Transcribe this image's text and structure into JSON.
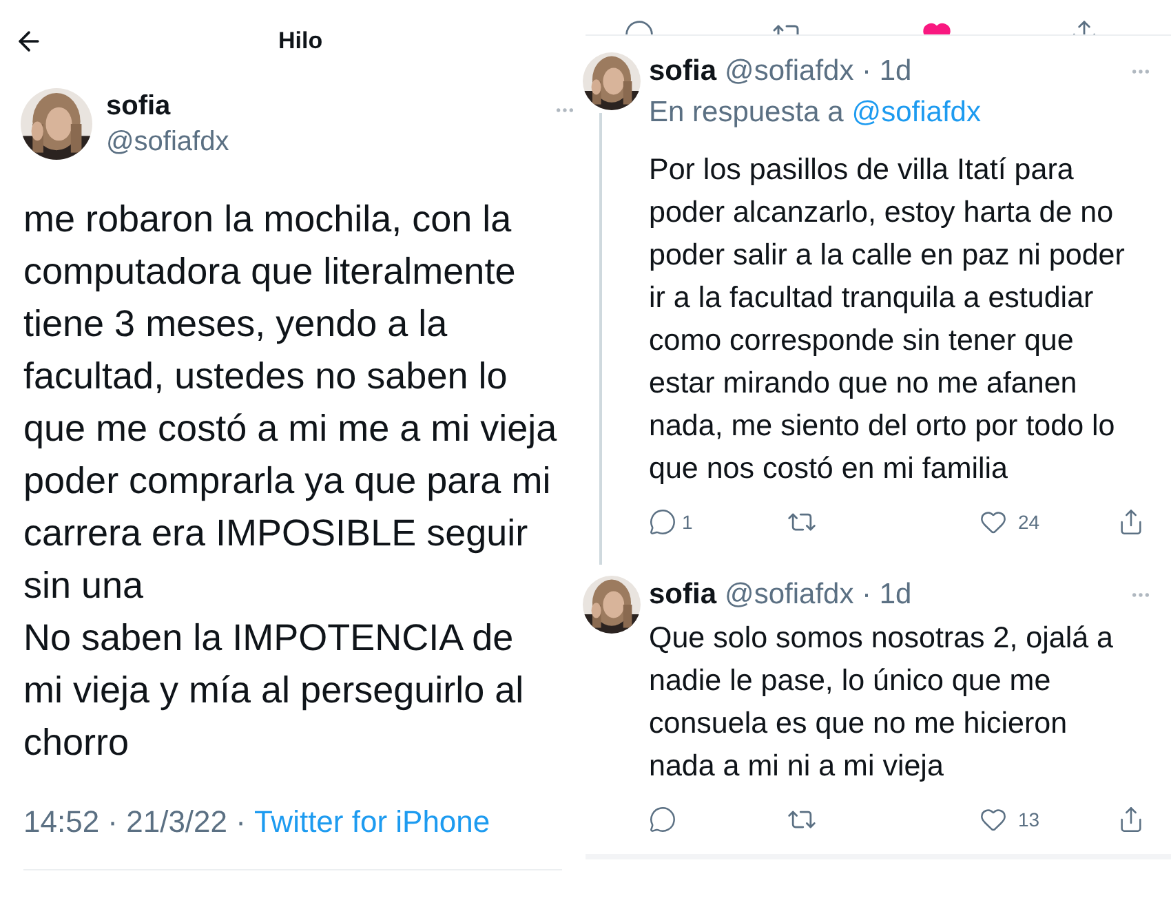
{
  "thread": {
    "title": "Hilo",
    "tweet": {
      "name": "sofia",
      "handle": "@sofiafdx",
      "paragraphs": [
        "me robaron la mochila, con la computadora que literalmente tiene 3 meses, yendo a la facultad, ustedes no saben lo que me costó a mi me a mi vieja poder comprarla ya que para mi carrera era IMPOSIBLE seguir sin una",
        "No saben la IMPOTENCIA de mi vieja y mía al perseguirlo al chorro"
      ],
      "timestamp": "14:52 · 21/3/22 ·",
      "source": "Twitter for iPhone"
    }
  },
  "replies_view": {
    "previous_actions": {
      "liked": true
    },
    "replies": [
      {
        "name": "sofia",
        "meta": "@sofiafdx · 1d",
        "reply_label": "En respuesta a",
        "reply_to": "@sofiafdx",
        "thread_line": true,
        "text": "Por los pasillos de villa Itatí para poder alcanzarlo, estoy harta de no poder salir a la calle en paz ni poder ir a la facultad tranquila a estudiar como corresponde sin tener que estar mirando que no me afanen nada, me siento del orto por todo lo que nos costó en mi familia",
        "reply_count": "1",
        "like_count": "24"
      },
      {
        "name": "sofia",
        "meta": "@sofiafdx · 1d",
        "thread_line": false,
        "text": "Que solo somos nosotras 2, ojalá a nadie le pase, lo único que me consuela es que no me hicieron nada a mi ni a mi vieja",
        "like_count": "13"
      }
    ]
  }
}
